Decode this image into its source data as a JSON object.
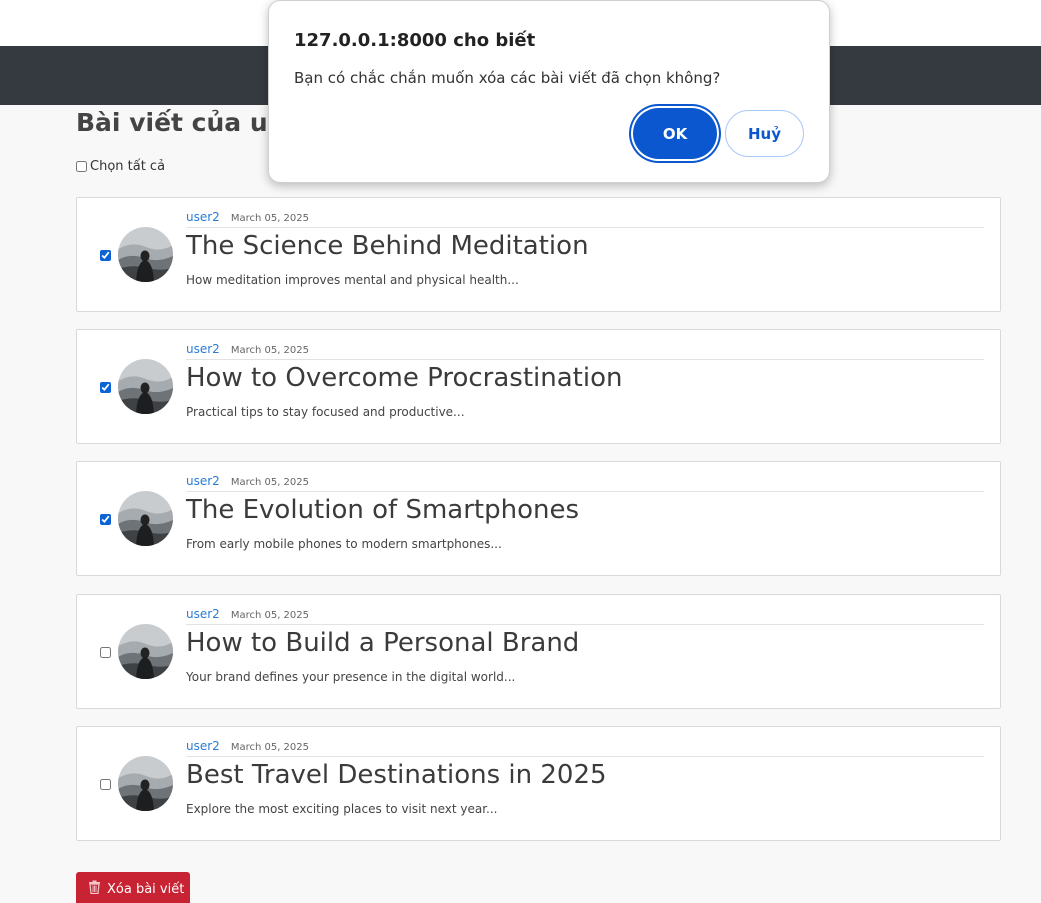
{
  "dialog": {
    "title": "127.0.0.1:8000 cho biết",
    "message": "Bạn có chắc chắn muốn xóa các bài viết đã chọn không?",
    "ok_label": "OK",
    "cancel_label": "Huỷ"
  },
  "page": {
    "title": "Bài viết của user2",
    "select_all_label": "Chọn tất cả",
    "delete_button_label": "Xóa bài viết",
    "delete_icon": "trash-icon"
  },
  "colors": {
    "navbar": "#343a40",
    "author_link": "#2a7bd5",
    "delete_button": "#c82333",
    "dialog_primary": "#0b57d0"
  },
  "posts": [
    {
      "author": "user2",
      "date": "March 05, 2025",
      "title": "The Science Behind Meditation",
      "excerpt": "How meditation improves mental and physical health...",
      "checked": true
    },
    {
      "author": "user2",
      "date": "March 05, 2025",
      "title": "How to Overcome Procrastination",
      "excerpt": "Practical tips to stay focused and productive...",
      "checked": true
    },
    {
      "author": "user2",
      "date": "March 05, 2025",
      "title": "The Evolution of Smartphones",
      "excerpt": "From early mobile phones to modern smartphones...",
      "checked": true
    },
    {
      "author": "user2",
      "date": "March 05, 2025",
      "title": "How to Build a Personal Brand",
      "excerpt": "Your brand defines your presence in the digital world...",
      "checked": false
    },
    {
      "author": "user2",
      "date": "March 05, 2025",
      "title": "Best Travel Destinations in 2025",
      "excerpt": "Explore the most exciting places to visit next year...",
      "checked": false
    }
  ]
}
